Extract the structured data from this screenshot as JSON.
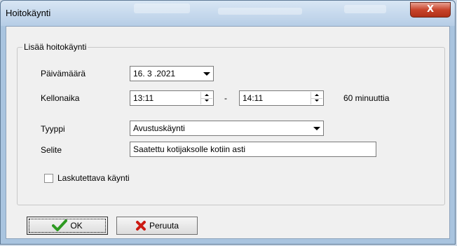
{
  "window": {
    "title": "Hoitokäynti",
    "close_symbol": "X"
  },
  "group": {
    "legend": "Lisää hoitokäynti"
  },
  "form": {
    "date_label": "Päivämäärä",
    "date_value": "16. 3 .2021",
    "time_label": "Kellonaika",
    "time_start": "13:11",
    "time_separator": "-",
    "time_end": "14:11",
    "duration_text": "60 minuuttia",
    "type_label": "Tyyppi",
    "type_value": "Avustuskäynti",
    "note_label": "Selite",
    "note_value": "Saatettu kotijaksolle kotiin asti",
    "billable_label": "Laskutettava käynti",
    "billable_checked": false
  },
  "buttons": {
    "ok_label": "OK",
    "cancel_label": "Peruuta"
  },
  "icons": {
    "ok": "check-icon",
    "cancel": "x-icon",
    "close": "close-icon"
  },
  "colors": {
    "close_button": "#c8442a",
    "check_green": "#2e9a22",
    "cancel_red": "#cc1a12"
  }
}
